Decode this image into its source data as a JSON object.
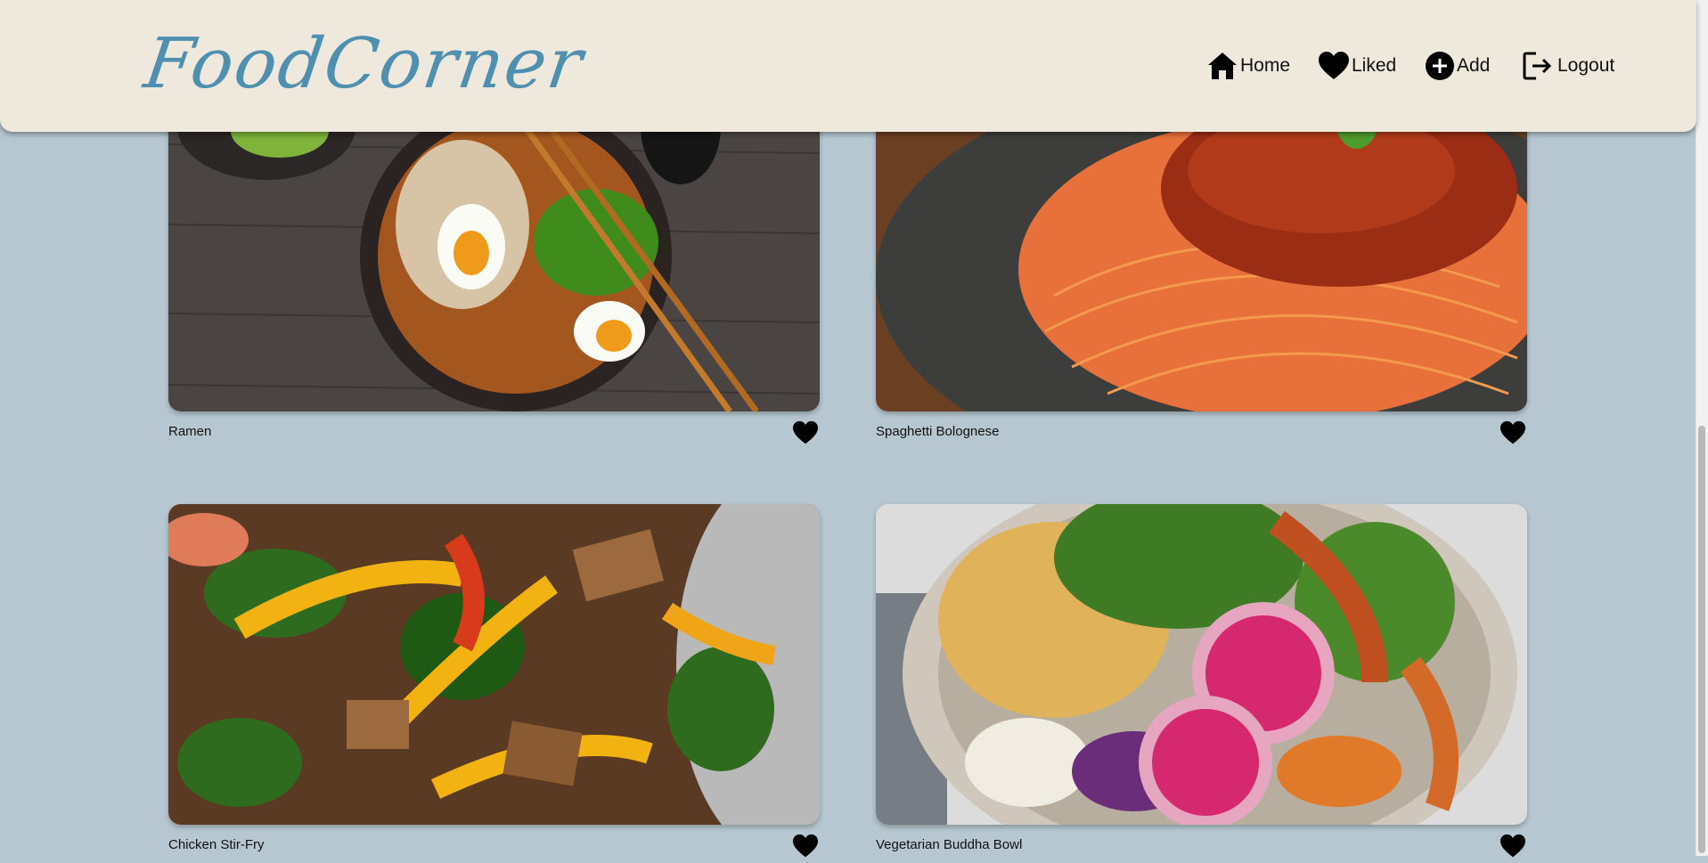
{
  "app": {
    "logo_text": "FoodCorner"
  },
  "nav": [
    {
      "label": "Home",
      "icon": "home-icon"
    },
    {
      "label": "Liked",
      "icon": "heart-icon"
    },
    {
      "label": "Add",
      "icon": "plus-circle-icon"
    },
    {
      "label": "Logout",
      "icon": "logout-icon"
    }
  ],
  "recipes": [
    {
      "title": "Ramen",
      "image": "ramen-photo",
      "liked": true
    },
    {
      "title": "Spaghetti Bolognese",
      "image": "spaghetti-photo",
      "liked": true
    },
    {
      "title": "Chicken Stir-Fry",
      "image": "stir-fry-photo",
      "liked": true
    },
    {
      "title": "Vegetarian Buddha Bowl",
      "image": "buddha-bowl-photo",
      "liked": true
    }
  ],
  "colors": {
    "background": "#b7c7d1",
    "header": "#efe9dd",
    "logo": "#4f8fb0",
    "icon": "#000000"
  }
}
